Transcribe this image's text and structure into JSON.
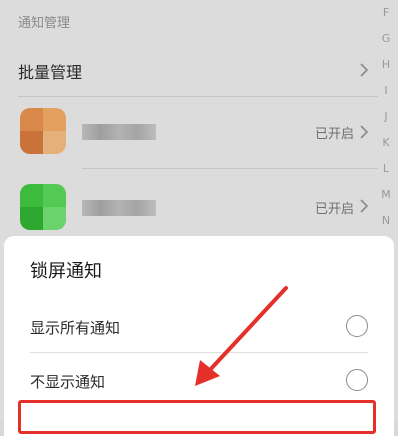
{
  "section": {
    "title": "通知管理"
  },
  "batch": {
    "label": "批量管理"
  },
  "apps": [
    {
      "status": "已开启",
      "icon_colors": [
        "#d98a4a",
        "#e3a05f",
        "#c9733a",
        "#e6b07a"
      ]
    },
    {
      "status": "已开启",
      "icon_colors": [
        "#3dbb3d",
        "#54c954",
        "#2ea82e",
        "#6bd36b"
      ]
    }
  ],
  "index_letters": [
    "F",
    "G",
    "H",
    "I",
    "J",
    "K",
    "L",
    "M",
    "N"
  ],
  "sheet": {
    "title": "锁屏通知",
    "options": [
      {
        "label": "显示所有通知"
      },
      {
        "label": "不显示通知"
      }
    ]
  },
  "colors": {
    "highlight": "#e5302a",
    "arrow": "#e5302a"
  }
}
